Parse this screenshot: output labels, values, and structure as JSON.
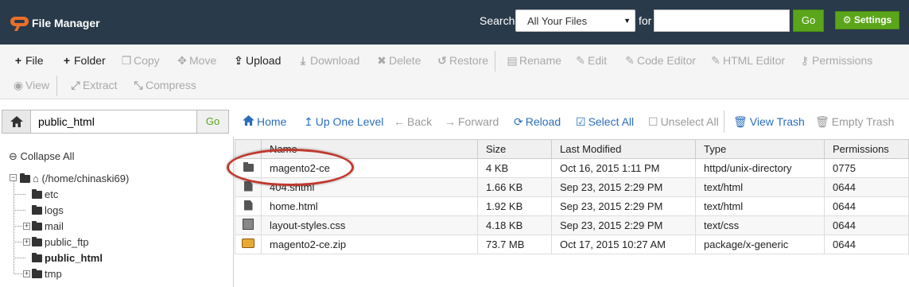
{
  "header": {
    "title": "File Manager",
    "search_label": "Search",
    "search_scope": "All Your Files",
    "for_label": "for",
    "search_value": "",
    "go_label": "Go",
    "settings_label": "Settings"
  },
  "toolbar": {
    "file": "File",
    "folder": "Folder",
    "copy": "Copy",
    "move": "Move",
    "upload": "Upload",
    "download": "Download",
    "delete": "Delete",
    "restore": "Restore",
    "rename": "Rename",
    "edit": "Edit",
    "code_editor": "Code Editor",
    "html_editor": "HTML Editor",
    "permissions": "Permissions",
    "view": "View",
    "extract": "Extract",
    "compress": "Compress"
  },
  "pathbar": {
    "path": "public_html",
    "go_label": "Go"
  },
  "nav": {
    "home": "Home",
    "up_one_level": "Up One Level",
    "back": "Back",
    "forward": "Forward",
    "reload": "Reload",
    "select_all": "Select All",
    "unselect_all": "Unselect All",
    "view_trash": "View Trash",
    "empty_trash": "Empty Trash"
  },
  "tree": {
    "collapse_all": "Collapse All",
    "root": "(/home/chinaski69)",
    "items": [
      "etc",
      "logs",
      "mail",
      "public_ftp",
      "public_html",
      "tmp"
    ]
  },
  "table": {
    "columns": [
      "Name",
      "Size",
      "Last Modified",
      "Type",
      "Permissions"
    ],
    "rows": [
      {
        "name": "magento2-ce",
        "size": "4 KB",
        "modified": "Oct 16, 2015 1:11 PM",
        "type": "httpd/unix-directory",
        "perms": "0775",
        "icon": "folder-icon"
      },
      {
        "name": "404.shtml",
        "size": "1.66 KB",
        "modified": "Sep 23, 2015 2:29 PM",
        "type": "text/html",
        "perms": "0644",
        "icon": "html-file-icon"
      },
      {
        "name": "home.html",
        "size": "1.92 KB",
        "modified": "Sep 23, 2015 2:29 PM",
        "type": "text/html",
        "perms": "0644",
        "icon": "html-file-icon"
      },
      {
        "name": "layout-styles.css",
        "size": "4.18 KB",
        "modified": "Sep 23, 2015 2:29 PM",
        "type": "text/css",
        "perms": "0644",
        "icon": "css-file-icon"
      },
      {
        "name": "magento2-ce.zip",
        "size": "73.7 MB",
        "modified": "Oct 17, 2015 10:27 AM",
        "type": "package/x-generic",
        "perms": "0644",
        "icon": "zip-file-icon"
      }
    ]
  },
  "colors": {
    "header_bg": "#293a4a",
    "accent_green": "#5aa51a",
    "link_blue": "#2a6ebb",
    "logo_orange": "#e8702a",
    "annotation_red": "#c0392b"
  }
}
